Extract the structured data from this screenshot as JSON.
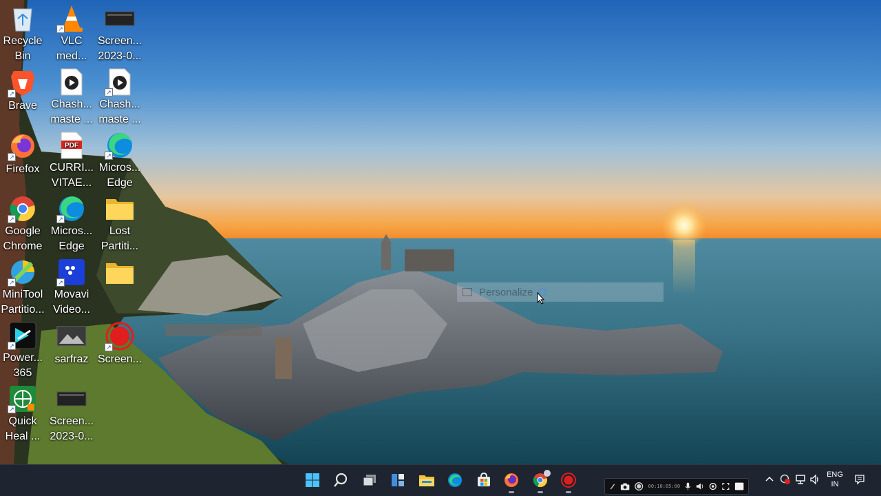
{
  "desktop": {
    "icons": [
      {
        "id": "recycle-bin",
        "label": "Recycle Bin",
        "icon": "recycle-bin-icon",
        "shortcut": false
      },
      {
        "id": "vlc",
        "label": "VLC med...",
        "icon": "vlc-cone-icon",
        "shortcut": true
      },
      {
        "id": "screen-1",
        "label": "Screen... 2023-0...",
        "icon": "screenshot-file-icon",
        "shortcut": false
      },
      {
        "id": "brave",
        "label": "Brave",
        "icon": "brave-lion-icon",
        "shortcut": true
      },
      {
        "id": "chash-1",
        "label": "Chash... maste ...",
        "icon": "media-file-icon",
        "shortcut": false
      },
      {
        "id": "chash-2",
        "label": "Chash... maste ...",
        "icon": "media-file-icon",
        "shortcut": true
      },
      {
        "id": "firefox",
        "label": "Firefox",
        "icon": "firefox-icon",
        "shortcut": true
      },
      {
        "id": "cv",
        "label": "CURRI... VITAE...",
        "icon": "pdf-file-icon",
        "shortcut": false
      },
      {
        "id": "edge-1",
        "label": "Micros... Edge",
        "icon": "edge-icon",
        "shortcut": true
      },
      {
        "id": "chrome",
        "label": "Google Chrome",
        "icon": "chrome-icon",
        "shortcut": true
      },
      {
        "id": "edge-2",
        "label": "Micros... Edge",
        "icon": "edge-icon",
        "shortcut": true
      },
      {
        "id": "lost",
        "label": "Lost Partiti...",
        "icon": "folder-icon",
        "shortcut": false
      },
      {
        "id": "minitool",
        "label": "MiniTool Partitio...",
        "icon": "minitool-icon",
        "shortcut": true
      },
      {
        "id": "movavi",
        "label": "Movavi Video...",
        "icon": "movavi-icon",
        "shortcut": true
      },
      {
        "id": "folder-2",
        "label": "",
        "icon": "folder-icon",
        "shortcut": false
      },
      {
        "id": "power",
        "label": "Power... 365",
        "icon": "powerdirector-icon",
        "shortcut": true
      },
      {
        "id": "sarfraz",
        "label": "sarfraz",
        "icon": "image-file-icon",
        "shortcut": false
      },
      {
        "id": "screen-rec",
        "label": "Screen...",
        "icon": "screen-recorder-icon",
        "shortcut": true
      },
      {
        "id": "quickheal",
        "label": "Quick Heal ...",
        "icon": "quick-heal-icon",
        "shortcut": true
      },
      {
        "id": "screen-2",
        "label": "Screen... 2023-0...",
        "icon": "screenshot-file-icon",
        "shortcut": false
      }
    ]
  },
  "context_ghost": {
    "label": "Personalize"
  },
  "taskbar": {
    "apps": [
      {
        "id": "start",
        "icon": "windows-start-icon"
      },
      {
        "id": "search",
        "icon": "search-icon"
      },
      {
        "id": "task-view",
        "icon": "task-view-icon"
      },
      {
        "id": "widgets",
        "icon": "widgets-icon"
      },
      {
        "id": "explorer",
        "icon": "file-explorer-icon"
      },
      {
        "id": "edge",
        "icon": "edge-icon"
      },
      {
        "id": "store",
        "icon": "store-icon"
      },
      {
        "id": "firefox",
        "icon": "firefox-icon"
      },
      {
        "id": "chrome",
        "icon": "chrome-icon"
      },
      {
        "id": "recorder",
        "icon": "screen-recorder-icon"
      }
    ],
    "recorder_time": "00:10:05:00",
    "language": {
      "line1": "ENG",
      "line2": "IN"
    }
  },
  "colors": {
    "taskbar": "#1e2530",
    "accent": "#1a73e8",
    "sky_top": "#2a6fc0",
    "sunset": "#f7a44a"
  }
}
